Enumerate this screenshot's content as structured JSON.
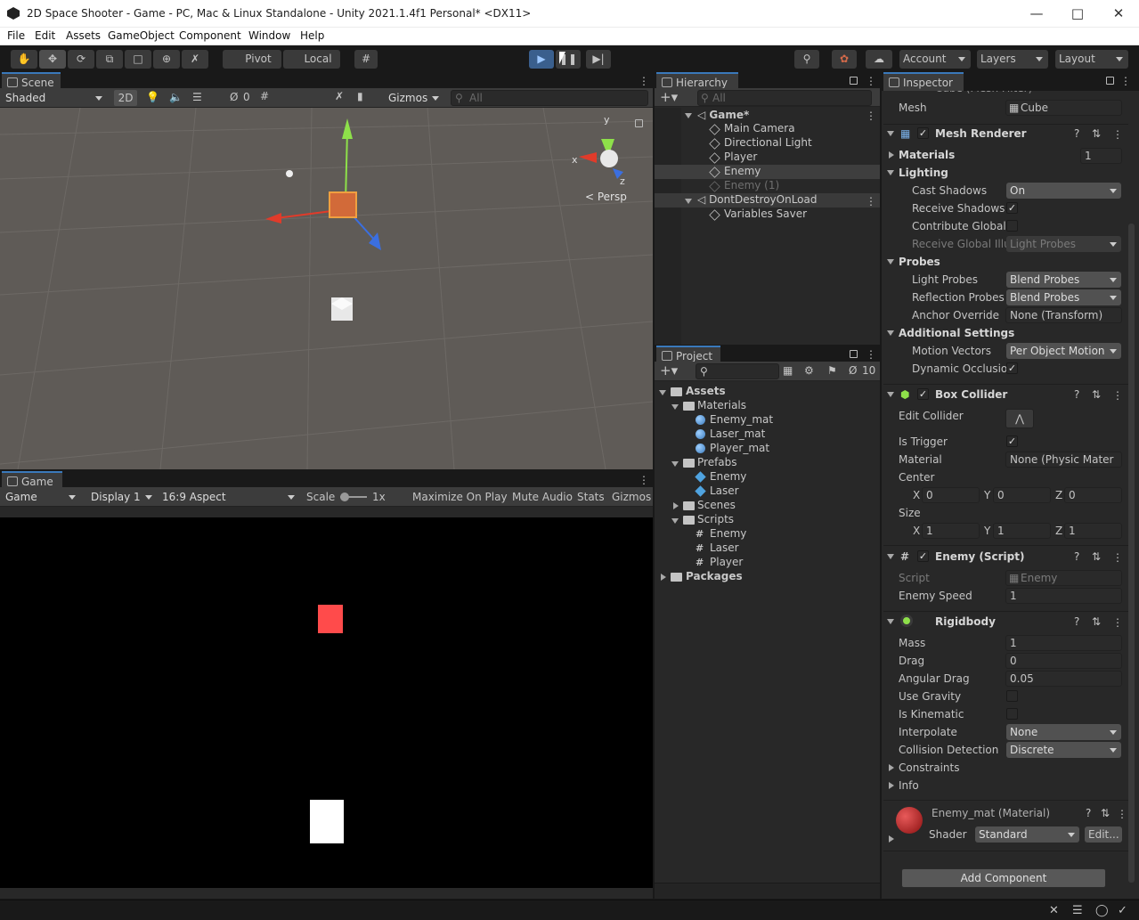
{
  "window": {
    "title": "2D Space Shooter - Game - PC, Mac & Linux Standalone - Unity 2021.1.4f1 Personal* <DX11>"
  },
  "menu": [
    "File",
    "Edit",
    "Assets",
    "GameObject",
    "Component",
    "Window",
    "Help"
  ],
  "toolbar": {
    "pivot": "Pivot",
    "local": "Local",
    "account": "Account",
    "layers": "Layers",
    "layout": "Layout"
  },
  "scene": {
    "tab": "Scene",
    "shading": "Shaded",
    "mode_2d": "2D",
    "hidden_count": "0",
    "gizmos": "Gizmos",
    "search_placeholder": "All",
    "persp": "< Persp",
    "axis_x": "x",
    "axis_y": "y",
    "axis_z": "z"
  },
  "game": {
    "tab": "Game",
    "mode": "Game",
    "display": "Display 1",
    "aspect": "16:9 Aspect",
    "scale_label": "Scale",
    "scale_value": "1x",
    "maximize": "Maximize On Play",
    "mute": "Mute Audio",
    "stats": "Stats",
    "gizmos": "Gizmos"
  },
  "hierarchy": {
    "tab": "Hierarchy",
    "search_placeholder": "All",
    "items": [
      {
        "label": "Game*",
        "kind": "scene"
      },
      {
        "label": "Main Camera",
        "kind": "object"
      },
      {
        "label": "Directional Light",
        "kind": "object"
      },
      {
        "label": "Player",
        "kind": "object"
      },
      {
        "label": "Enemy",
        "kind": "object",
        "selected": true
      },
      {
        "label": "Enemy (1)",
        "kind": "object",
        "disabled": true
      },
      {
        "label": "DontDestroyOnLoad",
        "kind": "scene"
      },
      {
        "label": "Variables Saver",
        "kind": "object"
      }
    ]
  },
  "project": {
    "tab": "Project",
    "hidden_count": "10",
    "tree": [
      {
        "label": "Assets",
        "kind": "folder"
      },
      {
        "label": "Materials",
        "kind": "folder"
      },
      {
        "label": "Enemy_mat",
        "kind": "material"
      },
      {
        "label": "Laser_mat",
        "kind": "material"
      },
      {
        "label": "Player_mat",
        "kind": "material"
      },
      {
        "label": "Prefabs",
        "kind": "folder"
      },
      {
        "label": "Enemy",
        "kind": "prefab"
      },
      {
        "label": "Laser",
        "kind": "prefab"
      },
      {
        "label": "Scenes",
        "kind": "folder"
      },
      {
        "label": "Scripts",
        "kind": "folder"
      },
      {
        "label": "Enemy",
        "kind": "script"
      },
      {
        "label": "Laser",
        "kind": "script"
      },
      {
        "label": "Player",
        "kind": "script"
      },
      {
        "label": "Packages",
        "kind": "folder"
      }
    ]
  },
  "inspector": {
    "tab": "Inspector",
    "top_cut": "Cube (Mesh Filter)",
    "mesh": {
      "label": "Mesh",
      "value": "Cube"
    },
    "mesh_renderer": {
      "title": "Mesh Renderer",
      "materials_label": "Materials",
      "materials_count": "1",
      "lighting": "Lighting",
      "cast_shadows": {
        "label": "Cast Shadows",
        "value": "On"
      },
      "receive_shadows": "Receive Shadows",
      "contribute_gi": "Contribute Global I",
      "receive_gi": {
        "label": "Receive Global Illu",
        "value": "Light Probes"
      },
      "probes": "Probes",
      "light_probes": {
        "label": "Light Probes",
        "value": "Blend Probes"
      },
      "reflection_probes": {
        "label": "Reflection Probes",
        "value": "Blend Probes"
      },
      "anchor_override": {
        "label": "Anchor Override",
        "value": "None (Transform)"
      },
      "additional": "Additional Settings",
      "motion_vectors": {
        "label": "Motion Vectors",
        "value": "Per Object Motion"
      },
      "dynamic_occlusion": "Dynamic Occlusio"
    },
    "box_collider": {
      "title": "Box Collider",
      "edit_collider": "Edit Collider",
      "is_trigger": "Is Trigger",
      "material": {
        "label": "Material",
        "value": "None (Physic Mater"
      },
      "center": {
        "label": "Center",
        "x": "0",
        "y": "0",
        "z": "0"
      },
      "size": {
        "label": "Size",
        "x": "1",
        "y": "1",
        "z": "1"
      },
      "axis_x": "X",
      "axis_y": "Y",
      "axis_z": "Z"
    },
    "enemy_script": {
      "title": "Enemy (Script)",
      "script": {
        "label": "Script",
        "value": "Enemy"
      },
      "speed": {
        "label": "Enemy Speed",
        "value": "1"
      }
    },
    "rigidbody": {
      "title": "Rigidbody",
      "mass": {
        "label": "Mass",
        "value": "1"
      },
      "drag": {
        "label": "Drag",
        "value": "0"
      },
      "angular_drag": {
        "label": "Angular Drag",
        "value": "0.05"
      },
      "use_gravity": "Use Gravity",
      "is_kinematic": "Is Kinematic",
      "interpolate": {
        "label": "Interpolate",
        "value": "None"
      },
      "collision": {
        "label": "Collision Detection",
        "value": "Discrete"
      },
      "constraints": "Constraints",
      "info": "Info"
    },
    "material": {
      "title": "Enemy_mat (Material)",
      "shader_label": "Shader",
      "shader_value": "Standard",
      "edit": "Edit..."
    },
    "add_component": "Add Component"
  },
  "colors": {
    "accent": "#3a79bb",
    "panel": "#282828",
    "selected_row": "#3e3e3e",
    "enemy_red": "#ff4b4b"
  }
}
